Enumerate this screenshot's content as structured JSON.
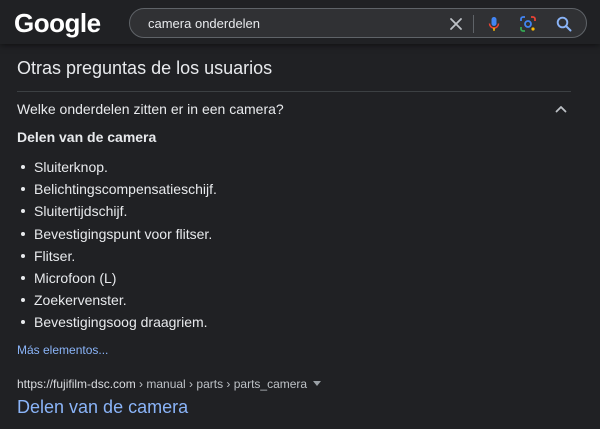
{
  "header": {
    "logo_text": "Google",
    "search": {
      "query": "camera onderdelen"
    },
    "icons": {
      "clear": "close-icon",
      "voice": "microphone-icon",
      "lens": "camera-lens-icon",
      "search": "search-icon"
    }
  },
  "paa": {
    "title": "Otras preguntas de los usuarios",
    "question": "Welke onderdelen zitten er in een camera?",
    "answer": {
      "heading": "Delen van de camera",
      "items": [
        "Sluiterknop.",
        "Belichtingscompensatieschijf.",
        "Sluitertijdschijf.",
        "Bevestigingspunt voor flitser.",
        "Flitser.",
        "Microfoon (L)",
        "Zoekervenster.",
        "Bevestigingsoog draagriem."
      ],
      "more_label": "Más elementos..."
    },
    "source": {
      "domain": "https://fujifilm-dsc.com",
      "path": " › manual › parts › parts_camera",
      "title": "Delen van de camera"
    }
  },
  "colors": {
    "background": "#202124",
    "link": "#8ab4f8",
    "text": "#e8eaed"
  }
}
